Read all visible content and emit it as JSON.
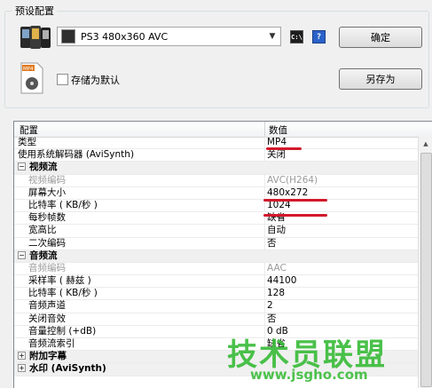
{
  "preset": {
    "group_title": "预设配置",
    "selected_preset": "PS3 480x360 AVC",
    "cli_icon": "command-line-icon",
    "help_icon": "help-icon",
    "ok_label": "确定",
    "save_as_label": "另存为",
    "save_default_label": "存储为默认",
    "save_default_checked": false,
    "mp4_icon": "mp4-file-icon",
    "device_icon": "device-phones-icon"
  },
  "grid": {
    "col_name": "配置",
    "col_value": "数值",
    "rows": [
      {
        "type": "prop",
        "name": "类型",
        "value": "MP4"
      },
      {
        "type": "prop",
        "name": "使用系统解码器 (AviSynth)",
        "value": "关闭"
      },
      {
        "type": "group",
        "name": "视频流",
        "expander": "⊟"
      },
      {
        "type": "child",
        "name": "视频编码",
        "value": "AVC(H264)",
        "disabled": true
      },
      {
        "type": "child",
        "name": "屏幕大小",
        "value": "480x272"
      },
      {
        "type": "child",
        "name": "比特率 ( KB/秒 )",
        "value": "1024"
      },
      {
        "type": "child",
        "name": "每秒帧数",
        "value": "缺省"
      },
      {
        "type": "child",
        "name": "宽高比",
        "value": "自动"
      },
      {
        "type": "child",
        "name": "二次编码",
        "value": "否"
      },
      {
        "type": "group",
        "name": "音频流",
        "expander": "⊟"
      },
      {
        "type": "child",
        "name": "音频编码",
        "value": "AAC",
        "disabled": true
      },
      {
        "type": "child",
        "name": "采样率 ( 赫兹 )",
        "value": "44100"
      },
      {
        "type": "child",
        "name": "比特率 ( KB/秒 )",
        "value": "128"
      },
      {
        "type": "child",
        "name": "音频声道",
        "value": "2"
      },
      {
        "type": "child",
        "name": "关闭音效",
        "value": "否"
      },
      {
        "type": "child",
        "name": "音量控制 (+dB)",
        "value": "0 dB"
      },
      {
        "type": "child",
        "name": "音频流索引",
        "value": "缺省"
      },
      {
        "type": "group",
        "name": "附加字幕",
        "expander": "⊞"
      },
      {
        "type": "group",
        "name": "水印 (AviSynth)",
        "expander": "⊞"
      }
    ]
  },
  "watermark": {
    "big": "技术员联盟",
    "small": "www.jsgho.com"
  },
  "colors": {
    "highlight_underline": "#d2192b",
    "watermark": "#3bbc3b"
  }
}
